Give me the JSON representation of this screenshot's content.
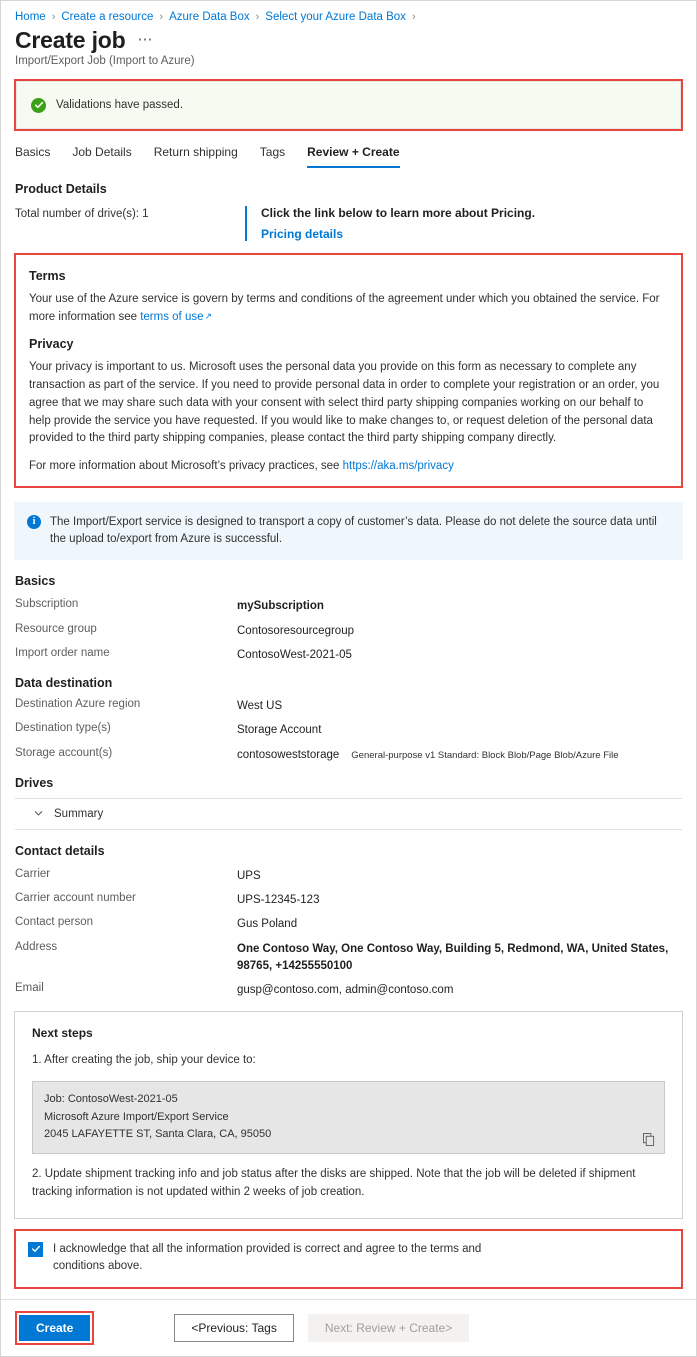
{
  "breadcrumb": {
    "items": [
      {
        "label": "Home"
      },
      {
        "label": "Create a resource"
      },
      {
        "label": "Azure Data Box"
      },
      {
        "label": "Select your Azure Data Box"
      }
    ],
    "separator": "›"
  },
  "header": {
    "title": "Create job",
    "ellipsis": "⋯",
    "subtitle": "Import/Export Job (Import to Azure)"
  },
  "validation": {
    "message": "Validations have passed.",
    "icon": "check-circle-icon",
    "background": "#f5fbf0",
    "icon_color": "#3aa017",
    "highlight_color": "#e8453c"
  },
  "tabs": [
    {
      "label": "Basics",
      "active": false
    },
    {
      "label": "Job Details",
      "active": false
    },
    {
      "label": "Return shipping",
      "active": false
    },
    {
      "label": "Tags",
      "active": false
    },
    {
      "label": "Review + Create",
      "active": true
    }
  ],
  "product_details": {
    "heading": "Product Details",
    "drive_count": "Total number of drive(s): 1",
    "pricing_title": "Click the link below to learn more about Pricing.",
    "pricing_link": "Pricing details",
    "accent_color": "#0078d4"
  },
  "terms": {
    "heading": "Terms",
    "body_prefix": "Your use of the Azure service is govern by terms and conditions of the agreement under which you obtained the service. For more information see ",
    "link": "terms of use",
    "privacy_heading": "Privacy",
    "privacy_body": "Your privacy is important to us. Microsoft uses the personal data you provide on this form as necessary to complete any transaction as part of the service. If you need to provide personal data in order to complete your registration or an order, you agree that we may share such data with your consent with select third party shipping companies working on our behalf to help provide the service you have requested. If you would like to make changes to, or request deletion of the personal data provided to the third party shipping companies, please contact the third party shipping company directly.",
    "privacy_more_prefix": "For more information about Microsoft’s privacy practices, see ",
    "privacy_link": "https://aka.ms/privacy"
  },
  "info_banner": {
    "text": "The Import/Export service is designed to transport a copy of customer’s data. Please do not delete the source data until the upload to/export from Azure is successful.",
    "icon": "info-icon",
    "background": "#eff6fc"
  },
  "basics": {
    "heading": "Basics",
    "rows": [
      {
        "key": "Subscription",
        "value": "mySubscription",
        "bold": true
      },
      {
        "key": "Resource group",
        "value": "Contosoresourcegroup",
        "bold": false
      },
      {
        "key": "Import order name",
        "value": "ContosoWest-2021-05",
        "bold": false
      }
    ]
  },
  "data_destination": {
    "heading": "Data destination",
    "rows": [
      {
        "key": "Destination Azure region",
        "value": "West US",
        "note": ""
      },
      {
        "key": "Destination type(s)",
        "value": "Storage Account",
        "note": ""
      },
      {
        "key": "Storage account(s)",
        "value": "contosoweststorage",
        "note": "General-purpose v1 Standard: Block Blob/Page Blob/Azure File"
      }
    ]
  },
  "drives": {
    "heading": "Drives",
    "summary_label": "Summary",
    "chevron": "chevron-down-icon"
  },
  "contact_details": {
    "heading": "Contact details",
    "rows": [
      {
        "key": "Carrier",
        "value": "UPS"
      },
      {
        "key": "Carrier account number",
        "value": "UPS-12345-123"
      },
      {
        "key": "Contact person",
        "value": "Gus Poland"
      },
      {
        "key": "Address",
        "value": "One Contoso Way, One Contoso Way, Building 5, Redmond, WA, United States, 98765, +14255550100",
        "bold": true
      },
      {
        "key": "Email",
        "value": "gusp@contoso.com, admin@contoso.com"
      }
    ]
  },
  "next_steps": {
    "title": "Next steps",
    "step1": "1. After creating the job, ship your device to:",
    "address_line1": "Job: ContosoWest-2021-05",
    "address_line2": "Microsoft Azure Import/Export Service",
    "address_line3": "2045 LAFAYETTE ST, Santa Clara, CA, 95050",
    "copy_icon": "copy-icon",
    "step2": "2. Update shipment tracking info and job status after the disks are shipped. Note that the job will be deleted if shipment tracking information is not updated within 2 weeks of job creation."
  },
  "acknowledge": {
    "checked": true,
    "label": "I acknowledge that all the information provided is correct and agree to the terms and conditions above."
  },
  "footer": {
    "create_label": "Create",
    "previous_label": "<Previous: Tags",
    "next_label": "Next: Review + Create>",
    "next_disabled": true
  }
}
